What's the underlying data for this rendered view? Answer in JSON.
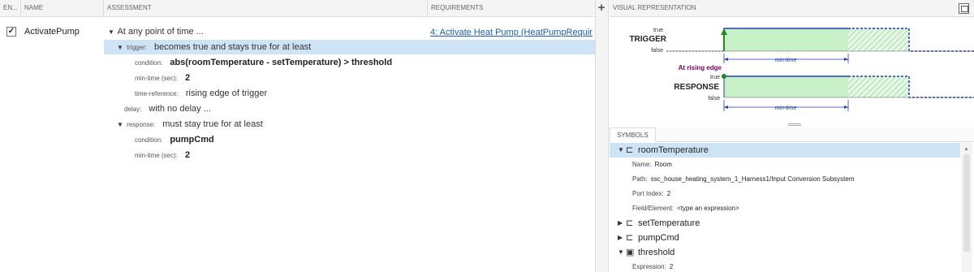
{
  "columns": {
    "enabled": "EN...",
    "name": "NAME",
    "assessment": "ASSESSMENT",
    "requirements": "REQUIREMENTS"
  },
  "assessment_row": {
    "checked": true,
    "name": "ActivatePump",
    "requirement_link": "4: Activate Heat Pump (HeatPumpRequir...",
    "summary": "At any point of time ...",
    "trigger": {
      "label": "trigger:",
      "text": "becomes true and stays true for at least",
      "condition_label": "condition:",
      "condition": "abs(roomTemperature - setTemperature) > threshold",
      "mintime_label": "min-time (sec):",
      "mintime": "2",
      "timeref_label": "time-reference:",
      "timeref": "rising edge of trigger"
    },
    "delay": {
      "label": "delay:",
      "text": "with no delay ..."
    },
    "response": {
      "label": "response:",
      "text": "must stay true for at least",
      "condition_label": "condition:",
      "condition": "pumpCmd",
      "mintime_label": "min-time (sec):",
      "mintime": "2"
    }
  },
  "add_button_label": "+",
  "visual": {
    "title": "VISUAL REPRESENTATION",
    "trigger_label": "TRIGGER",
    "response_label": "RESPONSE",
    "true_label": "true",
    "false_label": "false",
    "rising_edge_label": "At rising edge",
    "min_time_label": "min-time",
    "colors": {
      "signal": "#1f3fb0",
      "fill": "#c8f0c8",
      "hatch": "#8fd88f",
      "arrow": "#208a20",
      "edge_text": "#800060"
    }
  },
  "symbols": {
    "tab_label": "SYMBOLS",
    "items": [
      {
        "name": "roomTemperature",
        "icon": "signal-icon",
        "expanded": true,
        "selected": true,
        "details": [
          {
            "label": "Name:",
            "value": "Room"
          },
          {
            "label": "Path:",
            "value": "ssc_house_heating_system_1_Harness1/Input Conversion Subsystem"
          },
          {
            "label": "Port Index:",
            "value": "2"
          },
          {
            "label": "Field/Element:",
            "value": "<type an expression>"
          }
        ]
      },
      {
        "name": "setTemperature",
        "icon": "signal-icon",
        "expanded": false
      },
      {
        "name": "pumpCmd",
        "icon": "signal-icon",
        "expanded": false
      },
      {
        "name": "threshold",
        "icon": "parameter-icon",
        "expanded": true,
        "details": [
          {
            "label": "Expression:",
            "value": "2"
          }
        ]
      }
    ]
  }
}
